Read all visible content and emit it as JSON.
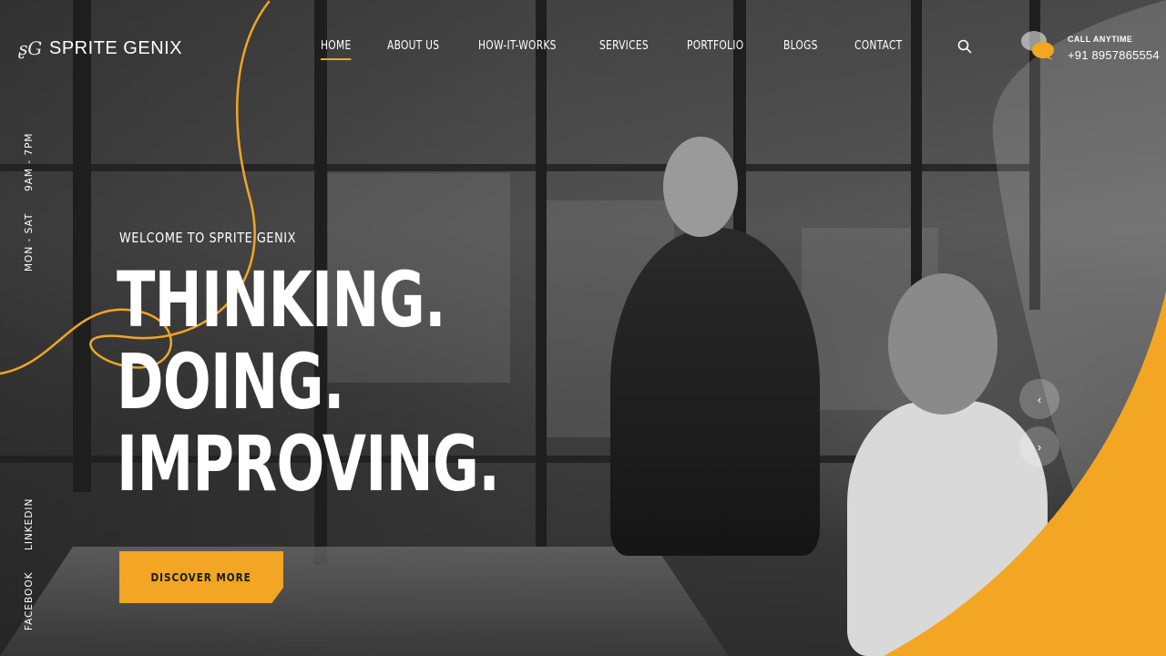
{
  "brand": {
    "name": "SPRITE GENIX"
  },
  "nav": {
    "items": [
      {
        "label": "HOME",
        "active": true
      },
      {
        "label": "ABOUT US",
        "active": false
      },
      {
        "label": "HOW-IT-WORKS",
        "active": false
      },
      {
        "label": "SERVICES",
        "active": false
      },
      {
        "label": "PORTFOLIO",
        "active": false
      },
      {
        "label": "BLOGS",
        "active": false
      },
      {
        "label": "CONTACT",
        "active": false
      }
    ]
  },
  "header": {
    "call_label": "CALL ANYTIME",
    "call_number": "+91 8957865554"
  },
  "side": {
    "hours": "9AM - 7PM",
    "days": "MON - SAT",
    "linkedin": "LINKEDIN",
    "facebook": "FACEBOOK"
  },
  "hero": {
    "welcome": "WELCOME TO SPRITE GENIX",
    "line1": "THINKING.",
    "line2": "DOING.",
    "line3": "IMPROVING.",
    "cta_label": "DISCOVER MORE"
  },
  "colors": {
    "accent": "#f2a623",
    "text": "#ffffff"
  },
  "icons": {
    "search": "search-icon",
    "call": "chat-bubbles-icon",
    "prev": "chevron-left-icon",
    "next": "chevron-right-icon",
    "logo": "logo-mark-icon"
  }
}
